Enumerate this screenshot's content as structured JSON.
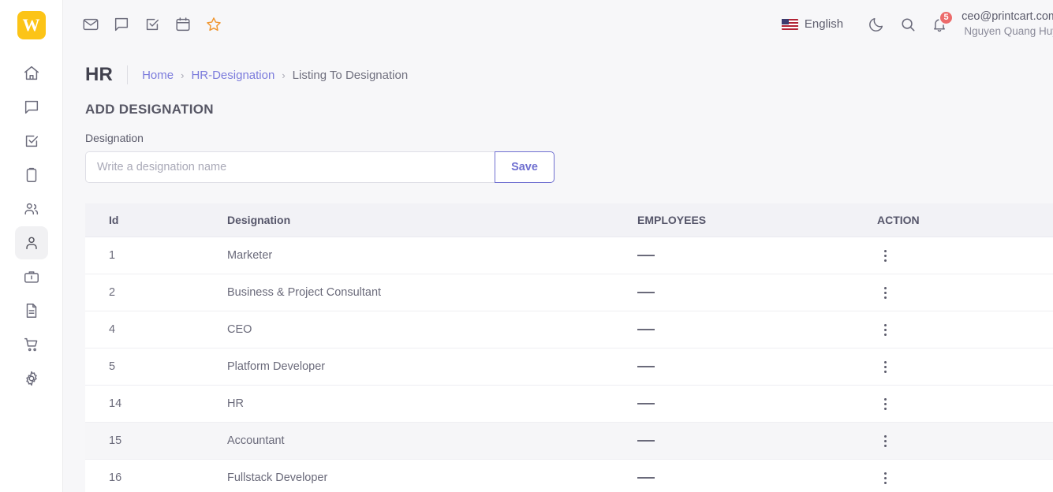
{
  "sidebar": {
    "logo_text": "W",
    "items": [
      {
        "icon": "home-icon",
        "name": "sidebar-item-home",
        "active": false
      },
      {
        "icon": "chat-icon",
        "name": "sidebar-item-chat",
        "active": false
      },
      {
        "icon": "task-icon",
        "name": "sidebar-item-tasks",
        "active": false
      },
      {
        "icon": "clipboard-icon",
        "name": "sidebar-item-clipboard",
        "active": false
      },
      {
        "icon": "users-icon",
        "name": "sidebar-item-users",
        "active": false
      },
      {
        "icon": "person-icon",
        "name": "sidebar-item-hr",
        "active": true
      },
      {
        "icon": "briefcase-icon",
        "name": "sidebar-item-projects",
        "active": false
      },
      {
        "icon": "document-icon",
        "name": "sidebar-item-documents",
        "active": false
      },
      {
        "icon": "cart-icon",
        "name": "sidebar-item-orders",
        "active": false
      },
      {
        "icon": "gear-icon",
        "name": "sidebar-item-settings",
        "active": false
      }
    ]
  },
  "topbar": {
    "left_icons": [
      {
        "icon": "mail-icon",
        "name": "mail-icon"
      },
      {
        "icon": "message-icon",
        "name": "message-icon"
      },
      {
        "icon": "todo-icon",
        "name": "todo-icon"
      },
      {
        "icon": "calendar-icon",
        "name": "calendar-icon"
      },
      {
        "icon": "star-icon",
        "name": "star-icon"
      }
    ],
    "language": "English",
    "language_flag": "us-flag-icon",
    "dark_mode_icon": "moon-icon",
    "search_icon": "search-icon",
    "notification_icon": "bell-icon",
    "notification_count": "5",
    "user_email": "ceo@printcart.com",
    "user_name": "Nguyen Quang Huy",
    "presence": "online"
  },
  "page": {
    "module": "HR",
    "breadcrumb": [
      {
        "label": "Home",
        "link": true
      },
      {
        "label": "HR-Designation",
        "link": true
      },
      {
        "label": "Listing To Designation",
        "link": false
      }
    ],
    "breadcrumb_separator": "›",
    "grid_button_icon": "grid-view-icon",
    "section_title": "ADD DESIGNATION"
  },
  "form": {
    "label": "Designation",
    "input_value": "",
    "input_placeholder": "Write a designation name",
    "save_label": "Save"
  },
  "table": {
    "columns": [
      "Id",
      "Designation",
      "EMPLOYEES",
      "ACTION"
    ],
    "rows": [
      {
        "id": "1",
        "designation": "Marketer",
        "employees": "——",
        "highlight": false
      },
      {
        "id": "2",
        "designation": "Business & Project Consultant",
        "employees": "——",
        "highlight": false
      },
      {
        "id": "4",
        "designation": "CEO",
        "employees": "——",
        "highlight": false
      },
      {
        "id": "5",
        "designation": "Platform Developer",
        "employees": "——",
        "highlight": false
      },
      {
        "id": "14",
        "designation": "HR",
        "employees": "——",
        "highlight": false
      },
      {
        "id": "15",
        "designation": "Accountant",
        "employees": "——",
        "highlight": true
      },
      {
        "id": "16",
        "designation": "Fullstack Developer",
        "employees": "——",
        "highlight": false
      }
    ],
    "action_icon": "kebab-menu-icon"
  },
  "colors": {
    "brand_yellow": "#fcc417",
    "accent_purple": "#7b7bdc",
    "button_blue": "#2c5cb5",
    "badge_red": "#ec6b6b",
    "presence_green": "#23c552",
    "page_bg": "#f7f7f9"
  }
}
